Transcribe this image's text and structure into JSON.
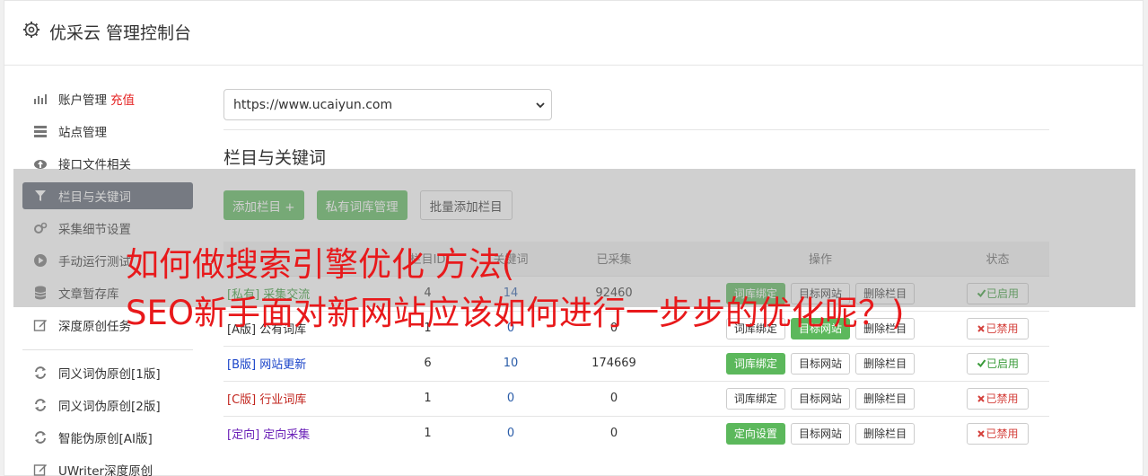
{
  "header": {
    "title": "优采云 管理控制台"
  },
  "sidebar": {
    "items": [
      {
        "label": "账户管理",
        "extra": "充值"
      },
      {
        "label": "站点管理"
      },
      {
        "label": "接口文件相关"
      },
      {
        "label": "栏目与关键词"
      },
      {
        "label": "采集细节设置"
      },
      {
        "label": "手动运行测试"
      },
      {
        "label": "文章暂存库"
      },
      {
        "label": "深度原创任务"
      },
      {
        "label": "同义词伪原创[1版]"
      },
      {
        "label": "同义词伪原创[2版]"
      },
      {
        "label": "智能伪原创[AI版]"
      },
      {
        "label": "UWriter深度原创"
      }
    ]
  },
  "main": {
    "site_select": "https://www.ucaiyun.com",
    "section_title": "栏目与关键词",
    "buttons": {
      "add_column": "添加栏目 +",
      "private_lib": "私有词库管理",
      "batch_add": "批量添加栏目"
    }
  },
  "table": {
    "headers": [
      "栏目ID",
      "关键词",
      "已采集",
      "操作",
      "状态"
    ],
    "rows": [
      {
        "name": "[私有] 采集交流",
        "id": "4",
        "kw": "14",
        "collected": "92460",
        "op1": "词库绑定",
        "op2": "目标网站",
        "op3": "删除栏目",
        "status": "已启用"
      },
      {
        "name": "[A版] 公有词库",
        "id": "1",
        "kw": "0",
        "collected": "0",
        "op1": "词库绑定",
        "op2": "目标网站",
        "op3": "删除栏目",
        "status": "已禁用"
      },
      {
        "name": "[B版] 网站更新",
        "id": "6",
        "kw": "10",
        "collected": "174669",
        "op1": "词库绑定",
        "op2": "目标网站",
        "op3": "删除栏目",
        "status": "已启用"
      },
      {
        "name": "[C版] 行业词库",
        "id": "1",
        "kw": "0",
        "collected": "0",
        "op1": "词库绑定",
        "op2": "目标网站",
        "op3": "删除栏目",
        "status": "已禁用"
      },
      {
        "name": "[定向] 定向采集",
        "id": "1",
        "kw": "0",
        "collected": "0",
        "op1": "定向设置",
        "op2": "目标网站",
        "op3": "删除栏目",
        "status": "已禁用"
      }
    ]
  },
  "overlay": {
    "line1": "如何做搜索引擎优化 方法(",
    "line2": "SEO新手面对新网站应该如何进行一步步的优化呢？)"
  },
  "colors": {
    "green": "#5cb85c",
    "active_nav": "#5b6371",
    "overlay_text": "#e8191b"
  }
}
